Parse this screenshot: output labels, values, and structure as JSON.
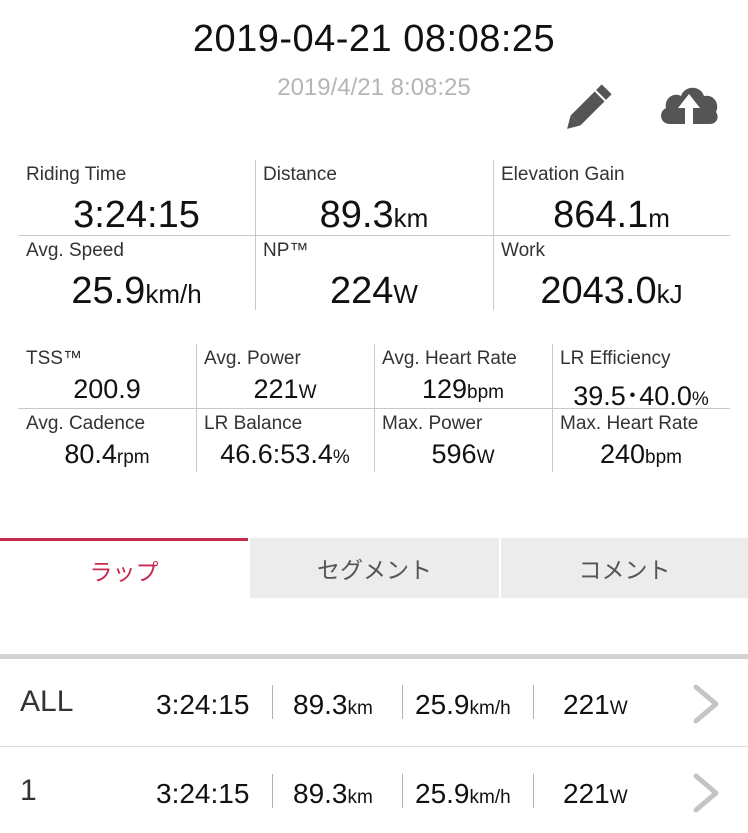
{
  "header": {
    "title": "2019-04-21 08:08:25",
    "subtitle": "2019/4/21 8:08:25"
  },
  "icons": {
    "edit": "pencil-icon",
    "upload": "cloud-upload-icon"
  },
  "main_stats": [
    {
      "label": "Riding Time",
      "value": "3:24:15",
      "unit": ""
    },
    {
      "label": "Distance",
      "value": "89.3",
      "unit": "km"
    },
    {
      "label": "Elevation Gain",
      "value": "864.1",
      "unit": "m"
    },
    {
      "label": "Avg. Speed",
      "value": "25.9",
      "unit": "km/h"
    },
    {
      "label": "NP™",
      "value": "224",
      "unit": "W"
    },
    {
      "label": "Work",
      "value": "2043.0",
      "unit": "kJ"
    }
  ],
  "sub_stats": [
    {
      "label": "TSS™",
      "value": "200.9",
      "unit": ""
    },
    {
      "label": "Avg. Power",
      "value": "221",
      "unit": "W"
    },
    {
      "label": "Avg. Heart Rate",
      "value": "129",
      "unit": "bpm"
    },
    {
      "label": "LR Efficiency",
      "value": "39.5･40.0",
      "unit": "%"
    },
    {
      "label": "Avg. Cadence",
      "value": "80.4",
      "unit": "rpm"
    },
    {
      "label": "LR Balance",
      "value": "46.6:53.4",
      "unit": "%"
    },
    {
      "label": "Max. Power",
      "value": "596",
      "unit": "W"
    },
    {
      "label": "Max. Heart Rate",
      "value": "240",
      "unit": "bpm"
    }
  ],
  "tabs": [
    {
      "label": "ラップ",
      "active": true
    },
    {
      "label": "セグメント",
      "active": false
    },
    {
      "label": "コメント",
      "active": false
    }
  ],
  "laps": [
    {
      "name": "ALL",
      "time": "3:24:15",
      "distance": "89.3",
      "distance_unit": "km",
      "speed": "25.9",
      "speed_unit": "km/h",
      "power": "221",
      "power_unit": "W"
    },
    {
      "name": "1",
      "time": "3:24:15",
      "distance": "89.3",
      "distance_unit": "km",
      "speed": "25.9",
      "speed_unit": "km/h",
      "power": "221",
      "power_unit": "W"
    }
  ],
  "colors": {
    "accent": "#c8294f",
    "tab_inactive_bg": "#ececec",
    "subtitle": "#b5b5b5"
  }
}
